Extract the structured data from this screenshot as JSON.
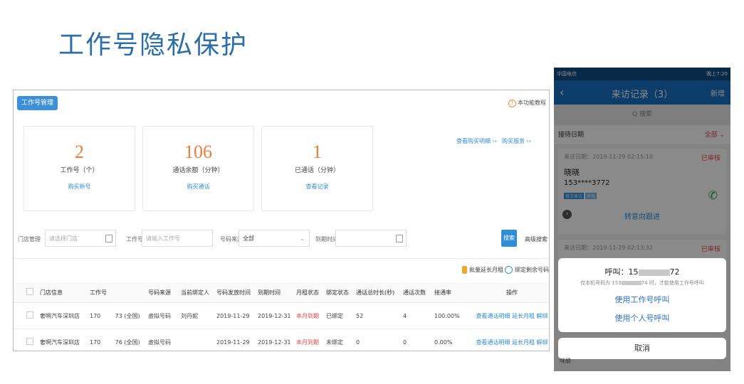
{
  "slide": {
    "title": "工作号隐私保护"
  },
  "admin": {
    "tab": "工作号管理",
    "tutorial": "本功能教程",
    "cards": [
      {
        "value": "2",
        "label": "工作号（个）",
        "link": "购买新号"
      },
      {
        "value": "106",
        "label": "通话余额（分钟）",
        "link": "购买通话"
      },
      {
        "value": "1",
        "label": "已通话（分钟）",
        "link": "查看记录"
      }
    ],
    "links": {
      "purchase_detail": "查看购买明细 ››",
      "buy_service": "购买服务 ››"
    },
    "filters": {
      "store_label": "门店管理",
      "store_placeholder": "请选择门店",
      "number_label": "工作号",
      "number_placeholder": "请输入工作号",
      "source_label": "号码来源",
      "source_value": "全部",
      "expire_label": "到期时间",
      "search": "搜索",
      "advanced": "高级搜索"
    },
    "actions": {
      "extend": "批量延长月租",
      "bind": "绑定剩余号码"
    },
    "table": {
      "headers": [
        "门店信息",
        "工作号",
        "号码来源",
        "当前绑定人",
        "号码发放时间",
        "到期时间",
        "月租状态",
        "绑定状态",
        "通话总时长(秒)",
        "通话次数",
        "接通率",
        "操作"
      ],
      "rows": [
        {
          "store": "奢啊汽车深圳店",
          "number": "170        73 (全国)",
          "source": "虚拟号码",
          "binder": "刘丹妮",
          "issued": "2019-11-29",
          "expire": "2019-12-31",
          "rent": "本月到期",
          "bind": "已绑定",
          "duration": "52",
          "calls": "4",
          "rate": "100.00%",
          "ops": "查看通话明细  延长月租  解绑"
        },
        {
          "store": "奢啊汽车深圳店",
          "number": "170        76 (全国)",
          "source": "虚拟号码",
          "binder": "",
          "issued": "2019-11-29",
          "expire": "2019-12-31",
          "rent": "本月到期",
          "bind": "未绑定",
          "duration": "0",
          "calls": "0",
          "rate": "0.00%",
          "ops": "查看通话明细  延长月租  解绑"
        }
      ]
    }
  },
  "phone": {
    "status_left": "中国电信",
    "status_right": "晚上7:20",
    "nav": {
      "back": "‹",
      "title": "来访记录（3）",
      "add": "新增"
    },
    "search": "Q 搜索",
    "date_filter": {
      "label": "接待日期",
      "value": "全部 ⌄"
    },
    "record1": {
      "meta": "来访日期：2019-11-29 02:15:10",
      "status": "已审核",
      "name": "晓晓",
      "phone": "153****3772",
      "tags": [
        "首次来访",
        "来电"
      ]
    },
    "transfer": "转意向跟进",
    "record2": {
      "meta": "来访日期：2019-11-29 02:13:32",
      "status": "已审核"
    },
    "dialog": {
      "call_prefix": "呼叫：15",
      "call_suffix": "72",
      "note_prefix": "仅本机号码为 153",
      "note_suffix": "74 时，才能使用工作号呼叫",
      "use_work": "使用工作号呼叫",
      "use_personal": "使用个人号呼叫"
    },
    "cancel": "取消",
    "bottom": "咪娘"
  }
}
